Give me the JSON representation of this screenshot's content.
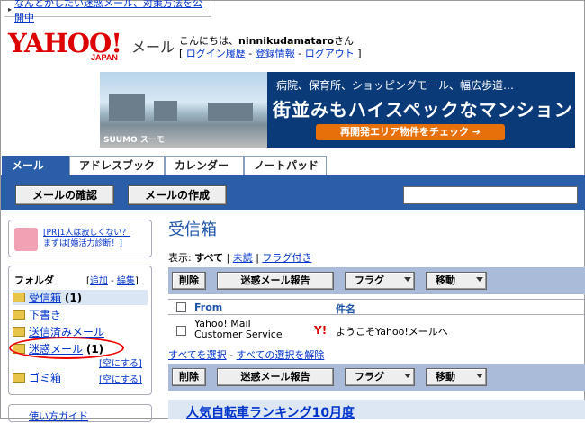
{
  "top_notice": "なんとかしたい迷惑メール、対策方法を公開中",
  "brand": {
    "logo": "YAHOO!",
    "sub": "JAPAN",
    "product": "メール"
  },
  "greeting": {
    "prefix": "こんにちは、",
    "user": "ninnikudamataro",
    "suffix": "さん",
    "links": [
      "ログイン履歴",
      "登録情報",
      "ログアウト"
    ]
  },
  "banner": {
    "line1": "病院、保育所、ショッピングモール、幅広歩道…",
    "line2": "街並みもハイスペックなマンション",
    "cta": "再開発エリア物件をチェック",
    "brand": "SUUMO スーモ"
  },
  "tabs": [
    "メール",
    "アドレスブック",
    "カレンダー",
    "ノートパッド"
  ],
  "toolbar": {
    "check": "メールの確認",
    "compose": "メールの作成",
    "search_placeholder": ""
  },
  "ad": {
    "line1": "[PR]1人は寂しくない？",
    "line2": "まずは[婚活力診断！]"
  },
  "folders": {
    "title": "フォルダ",
    "actions": [
      "追加",
      "編集"
    ],
    "items": [
      {
        "label": "受信箱",
        "count": "(1)"
      },
      {
        "label": "下書き",
        "count": ""
      },
      {
        "label": "送信済みメール",
        "count": ""
      },
      {
        "label": "迷惑メール",
        "count": "(1)"
      },
      {
        "label": "ゴミ箱",
        "count": ""
      }
    ],
    "empty_label": "[空にする]"
  },
  "guide": "使い方ガイド",
  "inbox": {
    "title": "受信箱",
    "filter_prefix": "表示:",
    "filters": [
      "すべて",
      "未読",
      "フラグ付き"
    ],
    "actions": [
      "削除",
      "迷惑メール報告",
      "フラグ",
      "移動"
    ],
    "columns": [
      "From",
      "件名"
    ],
    "messages": [
      {
        "from_line1": "Yahoo! Mail",
        "from_line2": "Customer Service",
        "subject": "ようこそYahoo!メールへ"
      }
    ],
    "select_all": "すべてを選択",
    "clear_all": "すべての選択を解除",
    "bottom_title": "人気自転車ランキング10月度"
  }
}
